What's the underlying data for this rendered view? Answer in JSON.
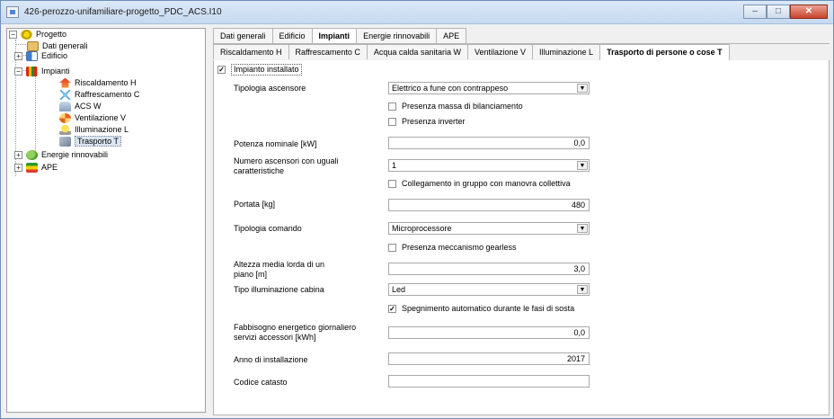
{
  "window": {
    "title": "426-perozzo-unifamiliare-progetto_PDC_ACS.I10"
  },
  "caption": {
    "minimize": "–",
    "maximize": "□",
    "close": "✕"
  },
  "tree": {
    "root": {
      "label": "Progetto",
      "expander": "−"
    },
    "dati_generali": "Dati generali",
    "edificio": {
      "label": "Edificio",
      "expander": "+"
    },
    "impianti": {
      "label": "Impianti",
      "expander": "−"
    },
    "riscaldamento": "Riscaldamento H",
    "raffrescamento": "Raffrescamento C",
    "acs": "ACS W",
    "ventilazione": "Ventilazione V",
    "illuminazione": "Illuminazione L",
    "trasporto": "Trasporto T",
    "energie": {
      "label": "Energie rinnovabili",
      "expander": "+"
    },
    "ape": {
      "label": "APE",
      "expander": "+"
    }
  },
  "tabs_top": [
    "Dati generali",
    "Edificio",
    "Impianti",
    "Energie rinnovabili",
    "APE"
  ],
  "tabs_sub": [
    "Riscaldamento H",
    "Raffrescamento C",
    "Acqua calda sanitaria W",
    "Ventilazione V",
    "Illuminazione L",
    "Trasporto di persone o cose T"
  ],
  "form": {
    "impianto_installato": {
      "label": "Impianto installato",
      "checked": "✓"
    },
    "tipologia_ascensore": {
      "label": "Tipologia ascensore",
      "value": "Elettrico a fune con contrappeso"
    },
    "massa_bilanciamento": {
      "label": "Presenza massa di bilanciamento",
      "checked": ""
    },
    "inverter": {
      "label": "Presenza inverter",
      "checked": ""
    },
    "potenza_nominale": {
      "label": "Potenza nominale [kW]",
      "value": "0,0"
    },
    "numero_ascensori": {
      "label_1": "Numero ascensori con uguali",
      "label_2": "caratteristiche",
      "value": "1"
    },
    "collegamento_gruppo": {
      "label": "Collegamento in gruppo con manovra collettiva",
      "checked": ""
    },
    "portata": {
      "label": "Portata [kg]",
      "value": "480"
    },
    "tipologia_comando": {
      "label": "Tipologia comando",
      "value": "Microprocessore"
    },
    "gearless": {
      "label": "Presenza meccanismo gearless",
      "checked": ""
    },
    "altezza_media": {
      "label_1": "Altezza media lorda di un",
      "label_2": "piano [m]",
      "value": "3,0"
    },
    "tipo_illuminazione": {
      "label": "Tipo illuminazione cabina",
      "value": "Led"
    },
    "spegnimento": {
      "label": "Spegnimento automatico durante le fasi di sosta",
      "checked": "✓"
    },
    "fabbisogno": {
      "label_1": "Fabbisogno energetico giornaliero",
      "label_2": "servizi accessori [kWh]",
      "value": "0,0"
    },
    "anno": {
      "label": "Anno di installazione",
      "value": "2017"
    },
    "catasto": {
      "label": "Codice catasto",
      "value": ""
    }
  },
  "dropdown_arrow": "▼"
}
